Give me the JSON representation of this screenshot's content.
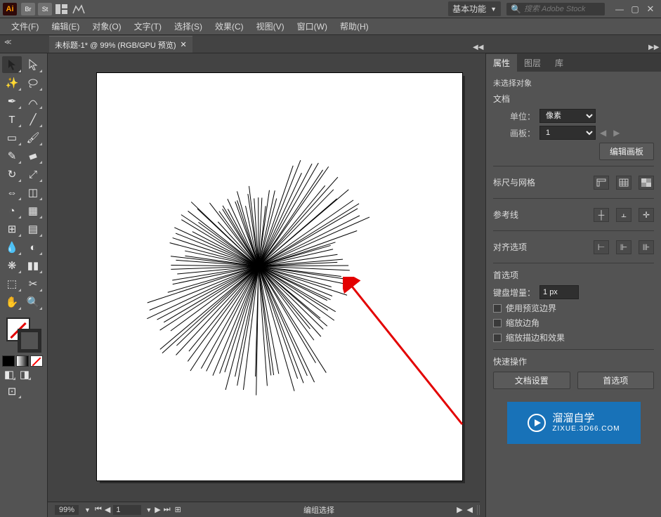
{
  "app": {
    "logo": "Ai",
    "badges": [
      "Br",
      "St"
    ],
    "workspace": "基本功能",
    "search_placeholder": "搜索 Adobe Stock"
  },
  "menu": {
    "items": [
      "文件(F)",
      "编辑(E)",
      "对象(O)",
      "文字(T)",
      "选择(S)",
      "效果(C)",
      "视图(V)",
      "窗口(W)",
      "帮助(H)"
    ]
  },
  "tab": {
    "title": "未标题-1* @ 99% (RGB/GPU 预览)"
  },
  "status": {
    "zoom": "99%",
    "artboard_num": "1",
    "mode": "编组选择"
  },
  "panel": {
    "tabs": [
      "属性",
      "图层",
      "库"
    ],
    "no_selection": "未选择对象",
    "section_document": "文档",
    "units_label": "单位：",
    "units_value": "像素",
    "artboard_label": "画板：",
    "artboard_value": "1",
    "edit_artboard_btn": "编辑画板",
    "section_rulergrid": "标尺与网格",
    "section_guides": "参考线",
    "section_snap": "对齐选项",
    "section_prefs": "首选项",
    "key_inc_label": "键盘增量：",
    "key_inc_value": "1 px",
    "chk_preview": "使用预览边界",
    "chk_scale_corner": "缩放边角",
    "chk_scale_stroke": "缩放描边和效果",
    "section_quick": "快速操作",
    "btn_docsetup": "文档设置",
    "btn_prefs": "首选项",
    "watermark_main": "溜溜自学",
    "watermark_sub": "ZIXUE.3D66.COM"
  }
}
